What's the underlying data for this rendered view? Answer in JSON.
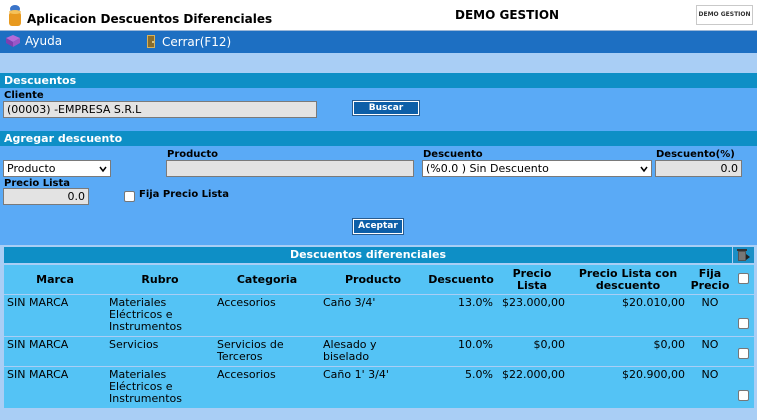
{
  "header": {
    "app_title": "Aplicacion Descuentos Diferenciales",
    "company": "DEMO GESTION",
    "logo_text": "DEMO GESTION"
  },
  "menu": {
    "help_label": "Ayuda",
    "close_label": "Cerrar(F12)"
  },
  "descuentos": {
    "section_title": "Descuentos",
    "client_label": "Cliente",
    "client_value": "(00003) -EMPRESA S.R.L",
    "search_button": "Buscar"
  },
  "add_discount": {
    "section_title": "Agregar descuento",
    "type_select": "Producto",
    "product_label": "Producto",
    "product_value": "",
    "discount_label": "Descuento",
    "discount_select": "(%0.0 ) Sin Descuento",
    "discount_pct_label": "Descuento(%)",
    "discount_pct_value": "0.0",
    "list_price_label": "Precio Lista",
    "list_price_value": "0.0",
    "fix_price_label": "Fija Precio Lista",
    "accept_button": "Aceptar"
  },
  "table": {
    "title": "Descuentos diferenciales",
    "columns": [
      "Marca",
      "Rubro",
      "Categoria",
      "Producto",
      "Descuento",
      "Precio Lista",
      "Precio Lista con descuento",
      "Fija Precio"
    ],
    "rows": [
      {
        "marca": "SIN MARCA",
        "rubro": "Materiales Eléctricos e Instrumentos",
        "categoria": "Accesorios",
        "producto": "Caño 3/4'",
        "descuento": "13.0%",
        "precio_lista": "$23.000,00",
        "precio_desc": "$20.010,00",
        "fija": "NO"
      },
      {
        "marca": "SIN MARCA",
        "rubro": "Servicios",
        "categoria": "Servicios de Terceros",
        "producto": "Alesado y biselado",
        "descuento": "10.0%",
        "precio_lista": "$0,00",
        "precio_desc": "$0,00",
        "fija": "NO"
      },
      {
        "marca": "SIN MARCA",
        "rubro": "Materiales Eléctricos e Instrumentos",
        "categoria": "Accesorios",
        "producto": "Caño 1' 3/4'",
        "descuento": "5.0%",
        "precio_lista": "$22.000,00",
        "precio_desc": "$20.900,00",
        "fija": "NO"
      }
    ]
  }
}
